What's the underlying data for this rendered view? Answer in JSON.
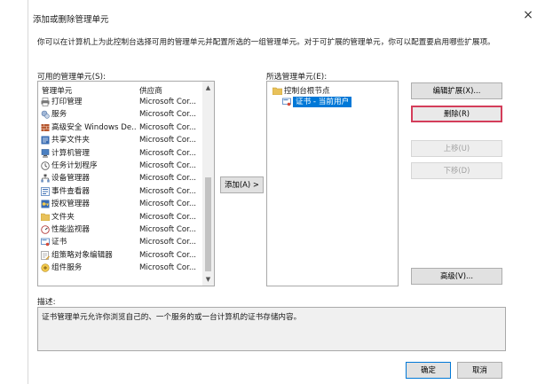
{
  "dialog": {
    "title": "添加或删除管理单元",
    "close_glyph": "×",
    "intro": "你可以在计算机上为此控制台选择可用的管理单元并配置所选的一组管理单元。对于可扩展的管理单元，你可以配置要启用哪些扩展项。"
  },
  "available": {
    "label": "可用的管理单元(S):",
    "headers": {
      "name": "管理单元",
      "vendor": "供应商"
    },
    "rows": [
      {
        "icon": "printer-icon",
        "name": "打印管理",
        "vendor": "Microsoft Cor..."
      },
      {
        "icon": "services-icon",
        "name": "服务",
        "vendor": "Microsoft Cor..."
      },
      {
        "icon": "firewall-icon",
        "name": "高级安全 Windows De...",
        "vendor": "Microsoft Cor..."
      },
      {
        "icon": "shared-folder-icon",
        "name": "共享文件夹",
        "vendor": "Microsoft Cor..."
      },
      {
        "icon": "computer-mgmt-icon",
        "name": "计算机管理",
        "vendor": "Microsoft Cor..."
      },
      {
        "icon": "scheduler-icon",
        "name": "任务计划程序",
        "vendor": "Microsoft Cor..."
      },
      {
        "icon": "device-mgr-icon",
        "name": "设备管理器",
        "vendor": "Microsoft Cor..."
      },
      {
        "icon": "event-viewer-icon",
        "name": "事件查看器",
        "vendor": "Microsoft Cor..."
      },
      {
        "icon": "authorization-icon",
        "name": "授权管理器",
        "vendor": "Microsoft Cor..."
      },
      {
        "icon": "folder-icon",
        "name": "文件夹",
        "vendor": "Microsoft Cor..."
      },
      {
        "icon": "perf-monitor-icon",
        "name": "性能监视器",
        "vendor": "Microsoft Cor..."
      },
      {
        "icon": "certificate-icon",
        "name": "证书",
        "vendor": "Microsoft Cor..."
      },
      {
        "icon": "gpo-editor-icon",
        "name": "组策略对象编辑器",
        "vendor": "Microsoft Cor..."
      },
      {
        "icon": "component-services-icon",
        "name": "组件服务",
        "vendor": "Microsoft Cor..."
      }
    ]
  },
  "add_button": "添加(A) >",
  "selected": {
    "label": "所选管理单元(E):",
    "root": "控制台根节点",
    "child": "证书 - 当前用户"
  },
  "buttons": {
    "edit_ext": "编辑扩展(X)...",
    "remove": "删除(R)",
    "move_up": "上移(U)",
    "move_down": "下移(D)",
    "advanced": "高级(V)...",
    "ok": "确定",
    "cancel": "取消"
  },
  "description": {
    "label": "描述:",
    "text": "证书管理单元允许你浏览自己的、一个服务的或一台计算机的证书存储内容。"
  },
  "colors": {
    "accent": "#0078d7",
    "selection": "#0078d7",
    "remove_border": "#d43d5a"
  }
}
